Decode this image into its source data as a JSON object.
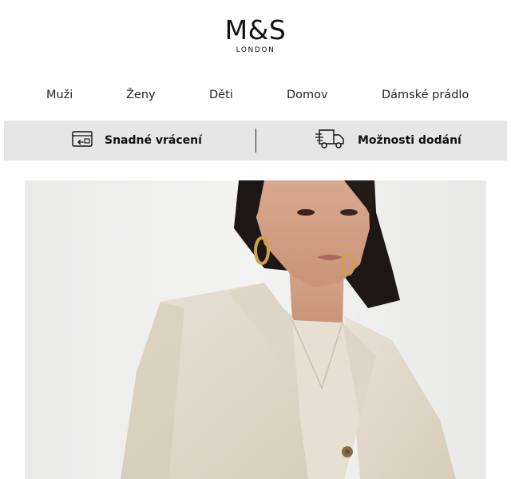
{
  "brand": {
    "name": "M&S",
    "tagline": "LONDON"
  },
  "nav": {
    "items": [
      {
        "label": "Muži"
      },
      {
        "label": "Ženy"
      },
      {
        "label": "Děti"
      },
      {
        "label": "Domov"
      },
      {
        "label": "Dámské prádlo"
      }
    ]
  },
  "services": {
    "returns_label": "Snadné vrácení",
    "returns_icon": "return-package-icon",
    "delivery_label": "Možnosti dodání",
    "delivery_icon": "delivery-truck-icon"
  },
  "hero": {
    "image": "woman-in-linen-suit-photo"
  },
  "colors": {
    "services_bg": "#e6e6e6",
    "text": "#111111",
    "hero_bg": "#efefed",
    "linen": "#e3dbcd"
  }
}
